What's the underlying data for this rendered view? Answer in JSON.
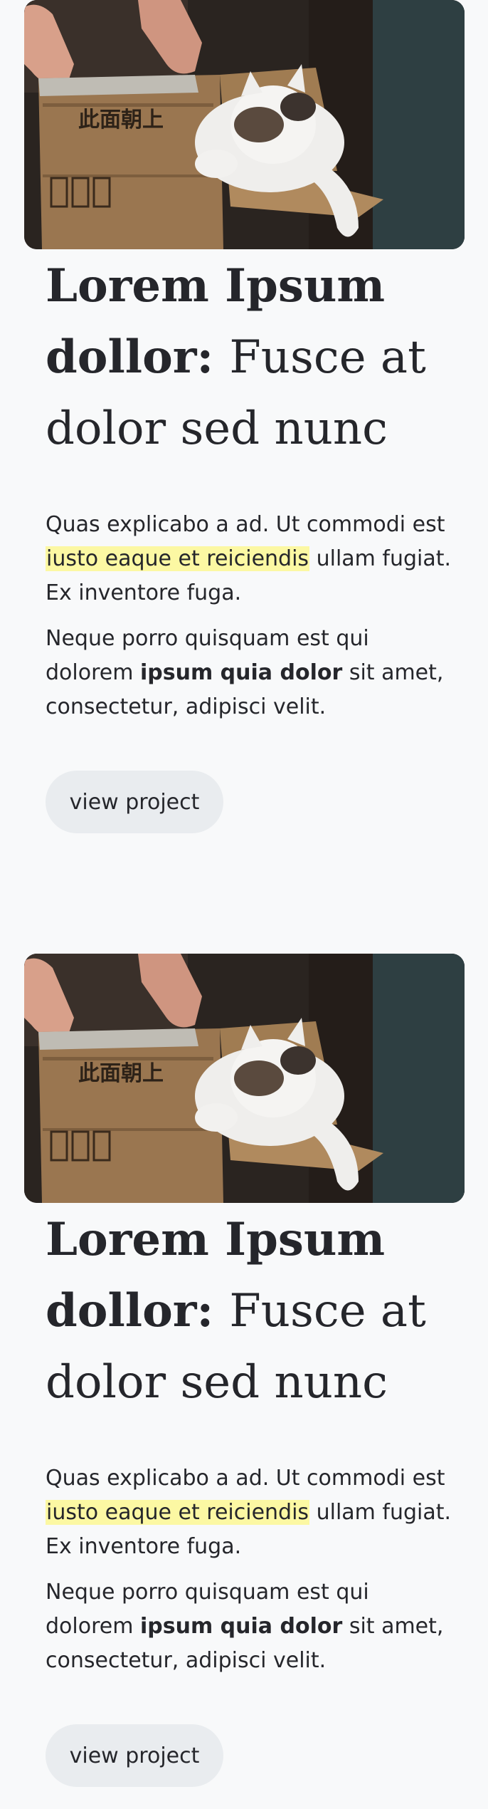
{
  "projects": [
    {
      "image_alt": "Cat in a cardboard box",
      "box_text": "此面朝上",
      "title_bold": "Lorem Ipsum dollor:",
      "title_regular": "Fusce at dolor sed nunc",
      "p1_before": "Quas explicabo a ad. Ut commodi est",
      "p1_highlight": "iusto eaque et reiciendis",
      "p1_after": "ullam fugiat. Ex inventore fuga.",
      "p2_before": "Neque porro quisquam est qui dolorem",
      "p2_bold": "ipsum quia dolor",
      "p2_after": "sit amet, consectetur, adipisci velit.",
      "button_label": "view project"
    },
    {
      "image_alt": "Cat in a cardboard box",
      "box_text": "此面朝上",
      "title_bold": "Lorem Ipsum dollor:",
      "title_regular": "Fusce at dolor sed nunc",
      "p1_before": "Quas explicabo a ad. Ut commodi est",
      "p1_highlight": "iusto eaque et reiciendis",
      "p1_after": "ullam fugiat. Ex inventore fuga.",
      "p2_before": "Neque porro quisquam est qui dolorem",
      "p2_bold": "ipsum quia dolor",
      "p2_after": "sit amet, consectetur, adipisci velit.",
      "button_label": "view project"
    }
  ],
  "colors": {
    "background": "#f8f9fa",
    "text": "#25262b",
    "highlight": "#fcf8a3",
    "button_bg": "#e9ecef"
  }
}
